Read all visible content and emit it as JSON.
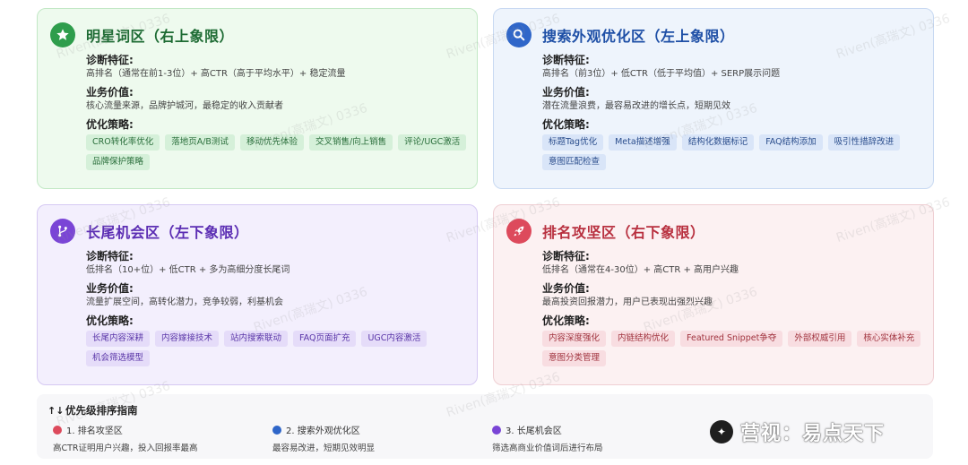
{
  "quadrants": {
    "star": {
      "title": "明星词区（右上象限）",
      "icon": "star-icon",
      "diag_h": "诊断特征:",
      "diag": "高排名（通常在前1-3位）+ 高CTR（高于平均水平）+ 稳定流量",
      "value_h": "业务价值:",
      "value": "核心流量来源，品牌护城河，最稳定的收入贡献者",
      "strat_h": "优化策略:",
      "tags": [
        "CRO转化率优化",
        "落地页A/B测试",
        "移动优先体验",
        "交叉销售/向上销售",
        "评论/UGC激活",
        "品牌保护策略"
      ]
    },
    "serp": {
      "title": "搜索外观优化区（左上象限）",
      "icon": "search-icon",
      "diag_h": "诊断特征:",
      "diag": "高排名（前3位）+ 低CTR（低于平均值）+ SERP展示问题",
      "value_h": "业务价值:",
      "value": "潜在流量浪费，最容易改进的增长点，短期见效",
      "strat_h": "优化策略:",
      "tags": [
        "标题Tag优化",
        "Meta描述增强",
        "结构化数据标记",
        "FAQ结构添加",
        "吸引性措辞改进",
        "意图匹配检查"
      ]
    },
    "longtail": {
      "title": "长尾机会区（左下象限）",
      "icon": "branch-icon",
      "diag_h": "诊断特征:",
      "diag": "低排名（10+位）+ 低CTR + 多为高细分度长尾词",
      "value_h": "业务价值:",
      "value": "流量扩展空间，高转化潜力，竞争较弱，利基机会",
      "strat_h": "优化策略:",
      "tags": [
        "长尾内容深耕",
        "内容嫁接技术",
        "站内搜索联动",
        "FAQ页面扩充",
        "UGC内容激活",
        "机会筛选模型"
      ]
    },
    "rank": {
      "title": "排名攻坚区（右下象限）",
      "icon": "rocket-icon",
      "diag_h": "诊断特征:",
      "diag": "低排名（通常在4-30位）+ 高CTR + 高用户兴趣",
      "value_h": "业务价值:",
      "value": "最高投资回报潜力，用户已表现出强烈兴趣",
      "strat_h": "优化策略:",
      "tags": [
        "内容深度强化",
        "内链结构优化",
        "Featured Snippet争夺",
        "外部权威引用",
        "核心实体补充",
        "意图分类管理"
      ]
    }
  },
  "guide": {
    "title": "优先级排序指南",
    "items": [
      {
        "label": "1. 排名攻坚区",
        "desc": "高CTR证明用户兴趣，投入回报率最高",
        "color": "#dd4a5c"
      },
      {
        "label": "2. 搜索外观优化区",
        "desc": "最容易改进，短期见效明显",
        "color": "#2f66c9"
      },
      {
        "label": "3. 长尾机会区",
        "desc": "筛选高商业价值词后进行布局",
        "color": "#7a45d6"
      }
    ]
  },
  "watermark": "Riven(高瑞文) 0336",
  "brand": "营视：易点天下"
}
